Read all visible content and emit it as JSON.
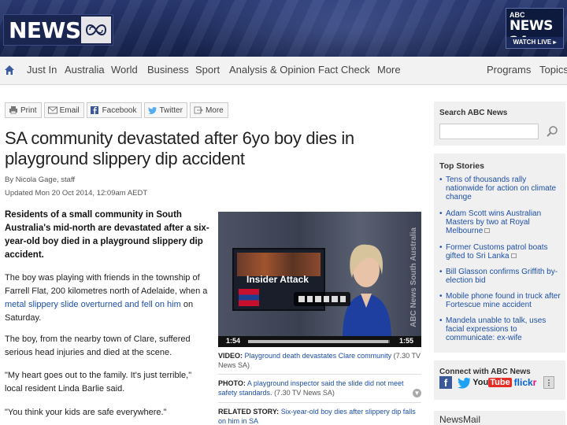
{
  "header": {
    "logo_text": "NEWS",
    "channel_small": "ABC",
    "channel_big": "NEWS 24",
    "watch_live": "WATCH LIVE ▸"
  },
  "nav": {
    "items": [
      "Just In",
      "Australia",
      "World",
      "Business",
      "Sport",
      "Analysis & Opinion",
      "Fact Check",
      "More"
    ],
    "right_items": [
      "Programs",
      "Topics"
    ]
  },
  "share": {
    "buttons": [
      "Print",
      "Email",
      "Facebook",
      "Twitter",
      "More"
    ]
  },
  "article": {
    "headline": "SA community devastated after 6yo boy dies in playground slippery dip accident",
    "byline": "By Nicola Gage, staff",
    "updated": "Updated Mon 20 Oct 2014, 12:09am AEDT",
    "lead": "Residents of a small community in South Australia's mid-north are devastated after a six-year-old boy died in a playground slippery dip accident.",
    "p1_text": "The boy was playing with friends in the township of Farrell Flat, 200 kilometres north of Adelaide, when a ",
    "p1_link": "metal slippery slide overturned and fell on him",
    "p1_end": " on Saturday.",
    "p2": "The boy, from the nearby town of Clare, suffered serious head injuries and died at the scene.",
    "p3": "\"My heart goes out to the family. It's just terrible,\" local resident Linda Barlie said.",
    "p4": "\"You think your kids are safe everywhere.\""
  },
  "video": {
    "overlay_text": "Insider Attack",
    "side_text": "ABC News South Australia",
    "time_current": "1:54",
    "time_total": "1:55",
    "progress": 0.99
  },
  "media": [
    {
      "label": "VIDEO:",
      "link": "Playground death devastates Clare community",
      "source": "(7.30 TV News SA)"
    },
    {
      "label": "PHOTO:",
      "link": "A playground inspector said the slide did not meet safety standards.",
      "source": "(7.30 TV News SA)"
    },
    {
      "label": "RELATED STORY:",
      "link": "Six-year-old boy dies after slippery dip falls on him in SA",
      "source": ""
    }
  ],
  "sidebar": {
    "search_title": "Search ABC News",
    "search_value": "",
    "top_stories_title": "Top Stories",
    "stories": [
      "Tens of thousands rally nationwide for action on climate change",
      "Adam Scott wins Australian Masters by two at Royal Melbourne",
      "Former Customs patrol boats gifted to Sri Lanka",
      "Bill Glasson confirms Griffith by-election bid",
      "Mobile phone found in truck after Fortescue mine accident",
      "Mandela unable to talk, uses facial expressions to communicate: ex-wife"
    ],
    "connect_title": "Connect with ABC News",
    "social": [
      "facebook",
      "twitter",
      "YouTube",
      "flickr",
      "more"
    ],
    "newsmail_title": "NewsMail"
  }
}
